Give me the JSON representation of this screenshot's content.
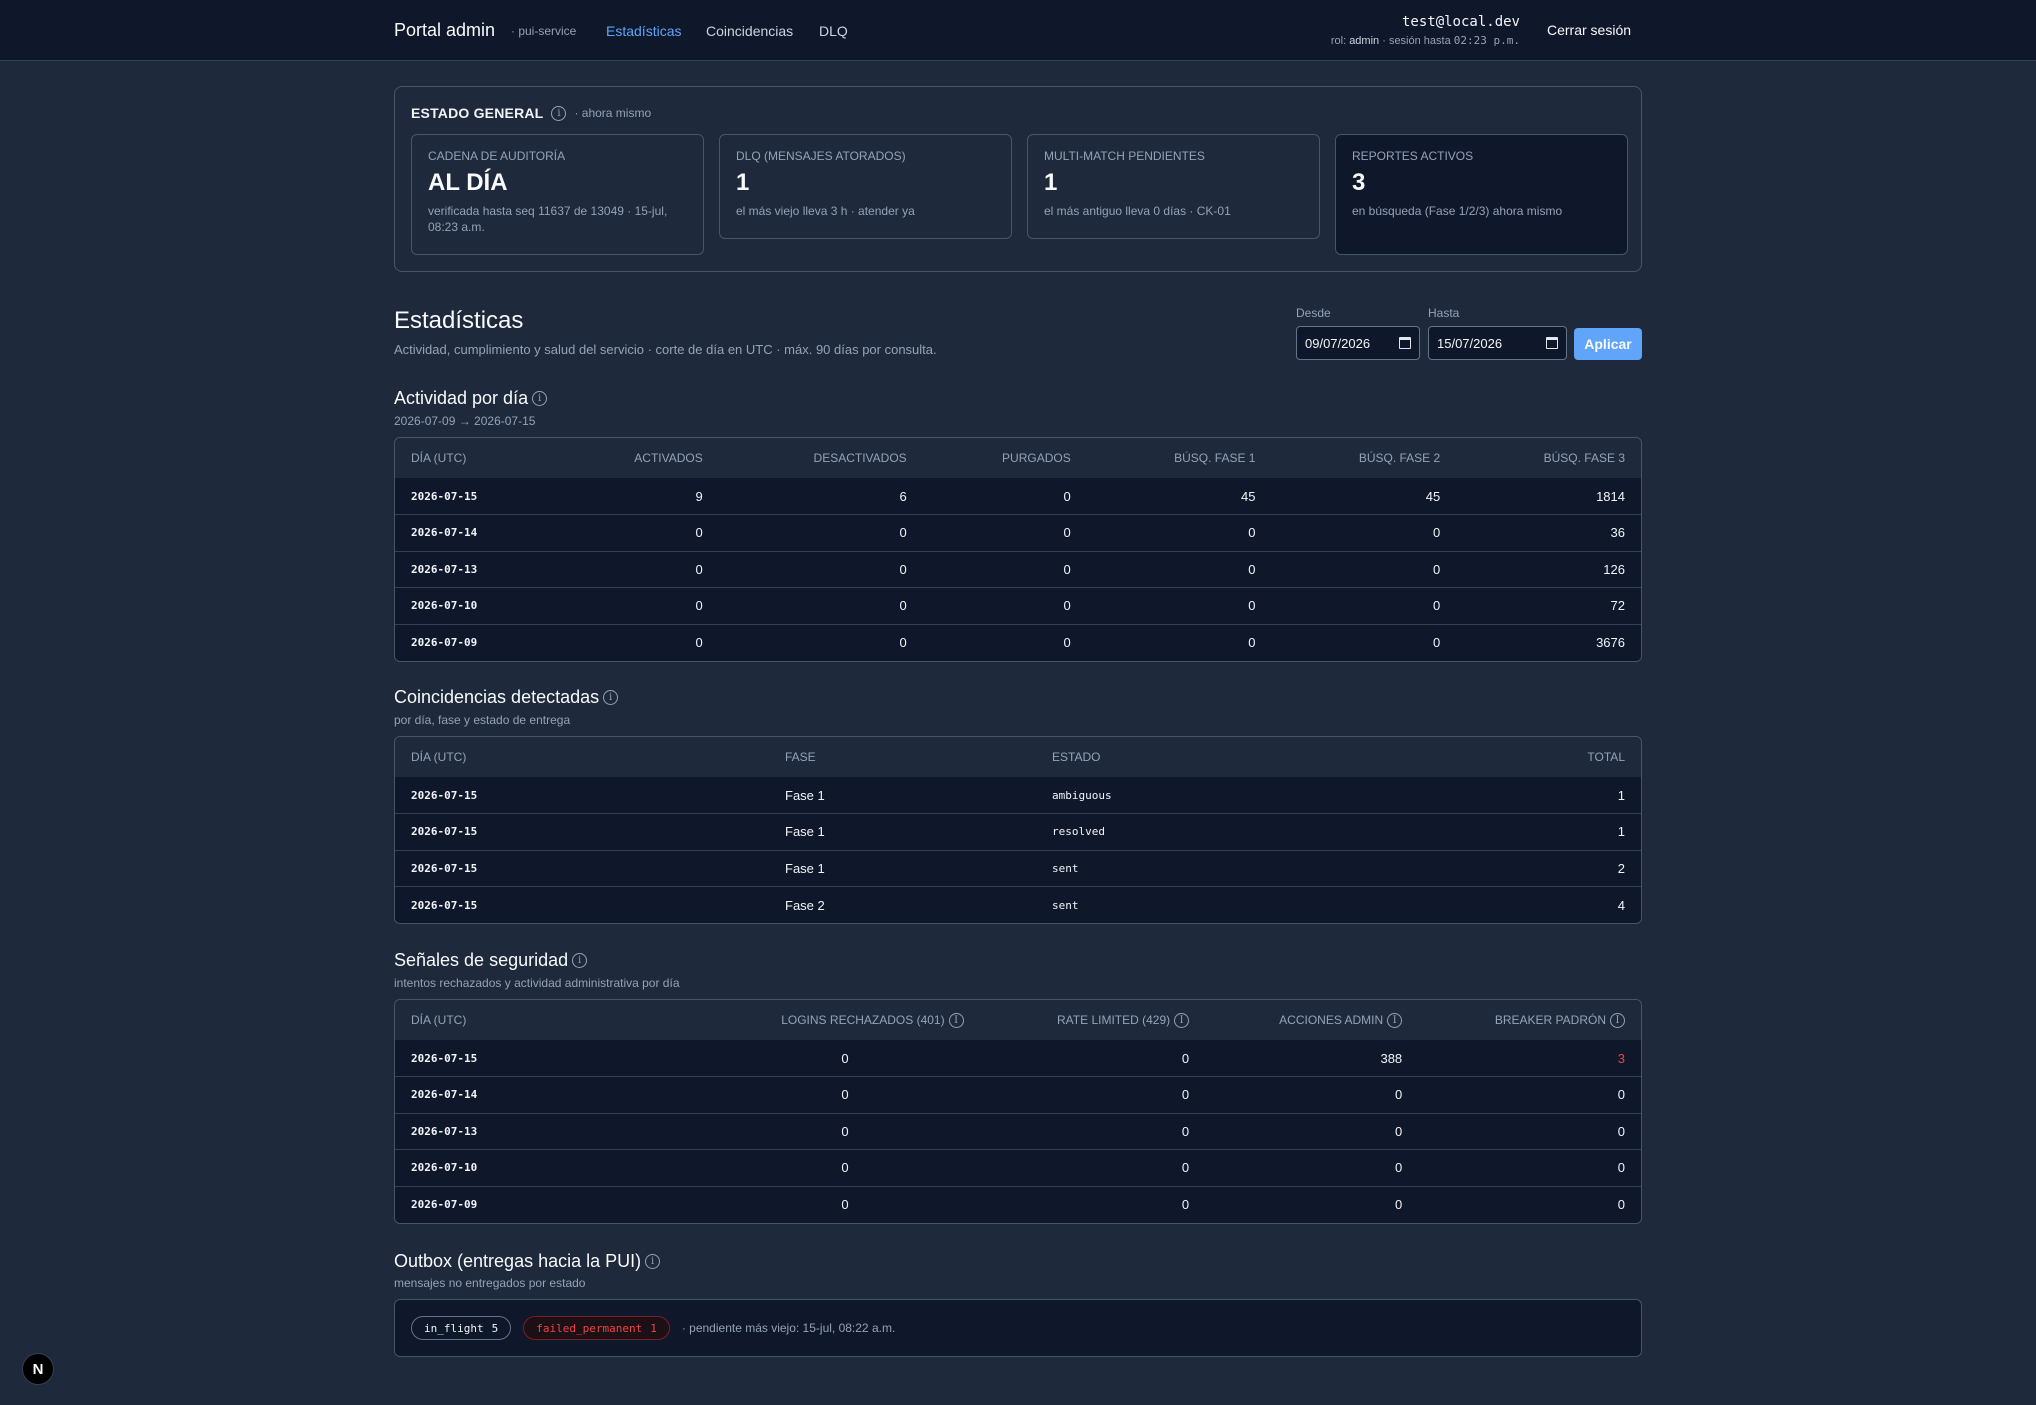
{
  "topbar": {
    "brand": "Portal admin",
    "brand_sub": "· pui-service",
    "nav": [
      {
        "label": "Estadísticas",
        "active": true
      },
      {
        "label": "Coincidencias",
        "active": false
      },
      {
        "label": "DLQ",
        "active": false
      }
    ],
    "user_email": "test@local.dev",
    "role_prefix": "rol:",
    "role": "admin",
    "session_prefix": "· sesión hasta",
    "session_until": "02:23 p.m.",
    "logout": "Cerrar sesión"
  },
  "estado": {
    "title": "ESTADO GENERAL",
    "when": "· ahora mismo",
    "kpis": [
      {
        "label": "Cadena de auditoría",
        "value": "AL DÍA",
        "desc": "verificada hasta seq 11637 de 13049 · 15-jul, 08:23 a.m."
      },
      {
        "label": "DLQ (mensajes atorados)",
        "value": "1",
        "desc": "el más viejo lleva 3 h · atender ya"
      },
      {
        "label": "Multi-match pendientes",
        "value": "1",
        "desc": "el más antiguo lleva 0 días · CK-01"
      },
      {
        "label": "Reportes activos",
        "value": "3",
        "desc": "en búsqueda (Fase 1/2/3) ahora mismo"
      }
    ]
  },
  "page": {
    "title": "Estadísticas",
    "subtitle": "Actividad, cumplimiento y salud del servicio · corte de día en UTC · máx. 90 días por consulta.",
    "from_label": "Desde",
    "from_value": "09/07/2026",
    "to_label": "Hasta",
    "to_value": "15/07/2026",
    "apply": "Aplicar"
  },
  "actividad": {
    "title": "Actividad por día",
    "range": "2026-07-09 → 2026-07-15",
    "headers": [
      "Día (UTC)",
      "Activados",
      "Desactivados",
      "Purgados",
      "Búsq. fase 1",
      "Búsq. fase 2",
      "Búsq. fase 3"
    ],
    "rows": [
      [
        "2026-07-15",
        "9",
        "6",
        "0",
        "45",
        "45",
        "1814"
      ],
      [
        "2026-07-14",
        "0",
        "0",
        "0",
        "0",
        "0",
        "36"
      ],
      [
        "2026-07-13",
        "0",
        "0",
        "0",
        "0",
        "0",
        "126"
      ],
      [
        "2026-07-10",
        "0",
        "0",
        "0",
        "0",
        "0",
        "72"
      ],
      [
        "2026-07-09",
        "0",
        "0",
        "0",
        "0",
        "0",
        "3676"
      ]
    ]
  },
  "coincidencias": {
    "title": "Coincidencias detectadas",
    "subtitle": "por día, fase y estado de entrega",
    "headers": [
      "Día (UTC)",
      "Fase",
      "Estado",
      "Total"
    ],
    "rows": [
      [
        "2026-07-15",
        "Fase 1",
        "ambiguous",
        "1"
      ],
      [
        "2026-07-15",
        "Fase 1",
        "resolved",
        "1"
      ],
      [
        "2026-07-15",
        "Fase 1",
        "sent",
        "2"
      ],
      [
        "2026-07-15",
        "Fase 2",
        "sent",
        "4"
      ]
    ]
  },
  "seguridad": {
    "title": "Señales de seguridad",
    "subtitle": "intentos rechazados y actividad administrativa por día",
    "headers": [
      "Día (UTC)",
      "Logins rechazados (401)",
      "Rate limited (429)",
      "Acciones admin",
      "Breaker padrón"
    ],
    "rows": [
      [
        "2026-07-15",
        "0",
        "0",
        "388",
        "3"
      ],
      [
        "2026-07-14",
        "0",
        "0",
        "0",
        "0"
      ],
      [
        "2026-07-13",
        "0",
        "0",
        "0",
        "0"
      ],
      [
        "2026-07-10",
        "0",
        "0",
        "0",
        "0"
      ],
      [
        "2026-07-09",
        "0",
        "0",
        "0",
        "0"
      ]
    ],
    "alert_color": "#ef4444"
  },
  "outbox": {
    "title": "Outbox (entregas hacia la PUI)",
    "subtitle": "mensajes no entregados por estado",
    "pills": [
      {
        "label": "in_flight",
        "count": "5"
      },
      {
        "label": "failed_permanent",
        "count": "1"
      }
    ],
    "note": "· pendiente más viejo: 15-jul, 08:22 a.m."
  },
  "dev_badge": "N"
}
